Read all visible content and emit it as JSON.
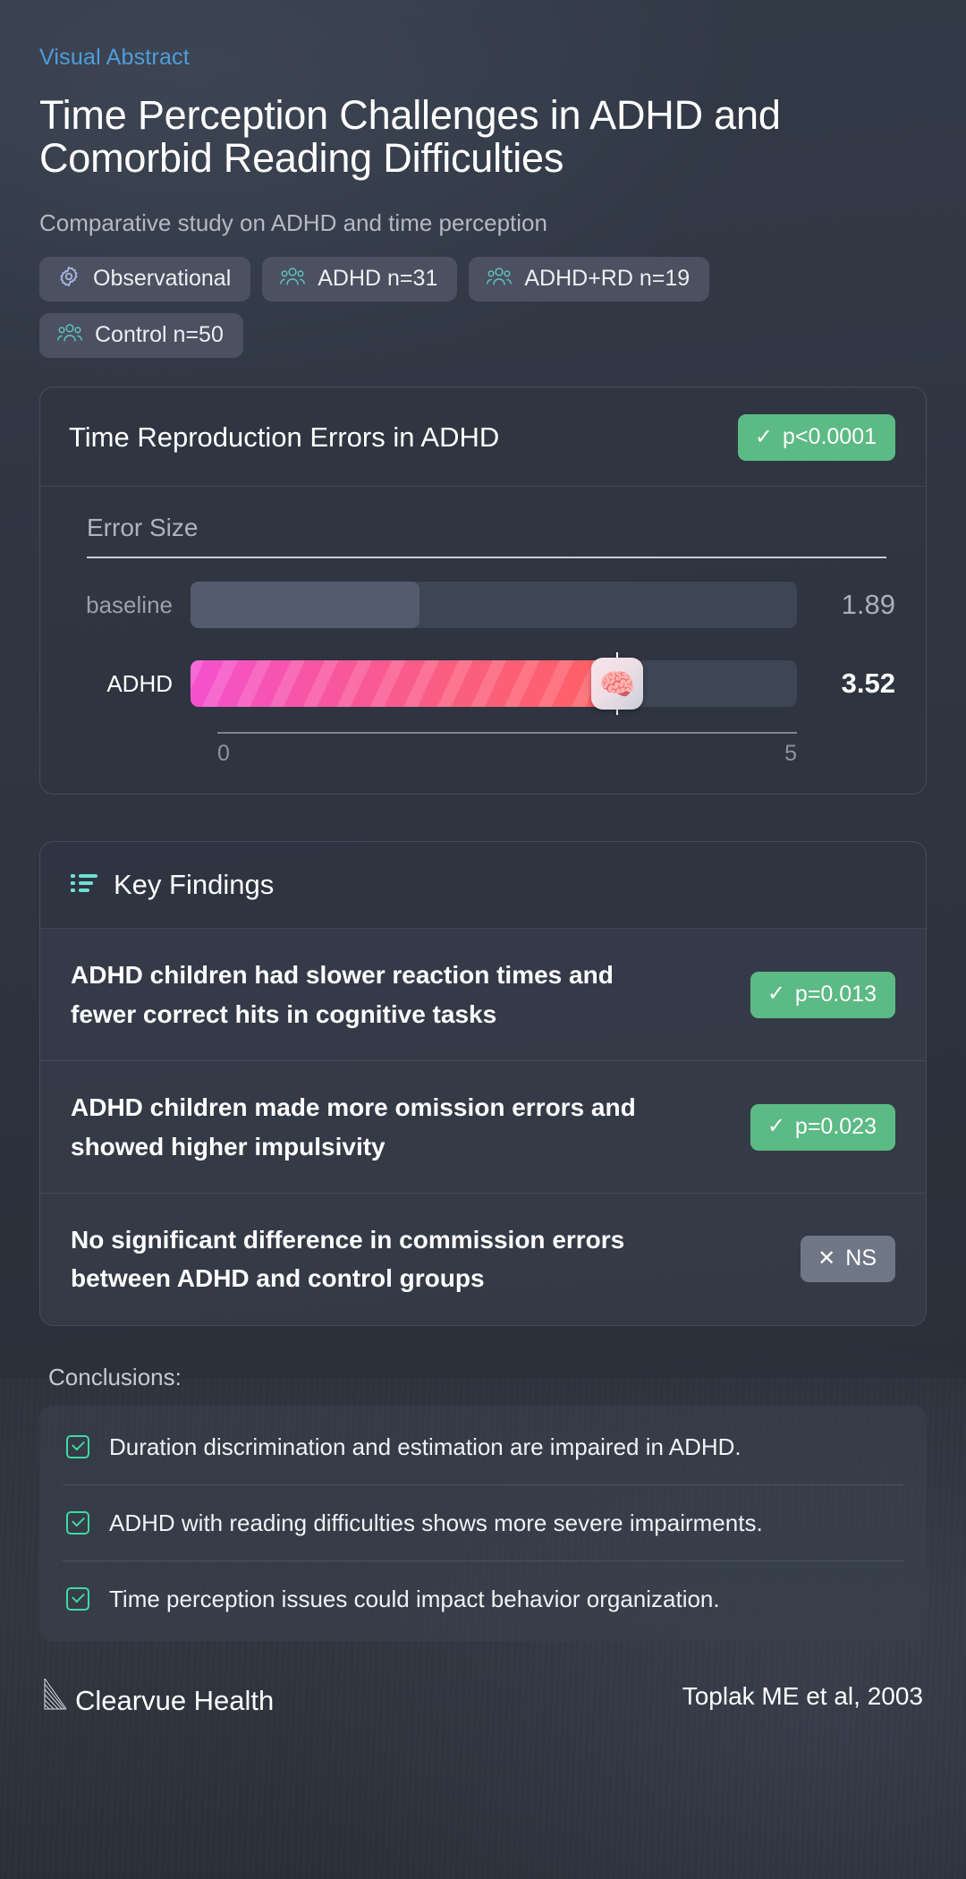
{
  "header": {
    "eyebrow": "Visual Abstract",
    "title": "Time Perception Challenges in ADHD and Comorbid Reading Difficulties",
    "subtitle": "Comparative study on ADHD and time perception"
  },
  "chips": [
    {
      "label": "Observational",
      "icon": "gear-icon"
    },
    {
      "label": "ADHD n=31",
      "icon": "people-icon"
    },
    {
      "label": "ADHD+RD n=19",
      "icon": "people-icon"
    },
    {
      "label": "Control n=50",
      "icon": "people-icon"
    }
  ],
  "chart_card": {
    "title": "Time Reproduction Errors in ADHD",
    "significance_badge": {
      "label": "p<0.0001",
      "icon": "check-icon",
      "color": "#5cba85"
    }
  },
  "chart_data": {
    "type": "bar",
    "title": "Time Reproduction Errors in ADHD",
    "xlabel": "Error Size",
    "ylabel": "",
    "categories": [
      "baseline",
      "ADHD"
    ],
    "values": [
      1.89,
      3.52
    ],
    "value_labels": [
      "1.89",
      "3.52"
    ],
    "xlim": [
      0,
      5
    ],
    "tick_labels": [
      "0",
      "5"
    ],
    "grid": false,
    "orientation": "horizontal",
    "highlight_category": "ADHD",
    "marker_icon": "brain-icon",
    "colors": {
      "baseline": "#545b6d",
      "primary_start": "#f452cf",
      "primary_end": "#ff6063",
      "track": "#3e4554"
    }
  },
  "key_findings": {
    "heading": "Key Findings",
    "icon": "list-icon",
    "items": [
      {
        "text": "ADHD children had slower reaction times and fewer correct hits in cognitive tasks",
        "badge": "p=0.013",
        "badge_icon": "check-icon",
        "badge_type": "significant"
      },
      {
        "text": "ADHD children made more omission errors and showed higher impulsivity",
        "badge": "p=0.023",
        "badge_icon": "check-icon",
        "badge_type": "significant"
      },
      {
        "text": "No significant difference in commission errors between ADHD and control groups",
        "badge": "NS",
        "badge_icon": "cross-icon",
        "badge_type": "not-significant"
      }
    ]
  },
  "conclusions": {
    "label": "Conclusions:",
    "items": [
      "Duration discrimination and estimation are impaired in ADHD.",
      "ADHD with reading difficulties shows more severe impairments.",
      "Time perception issues could impact behavior organization."
    ]
  },
  "footer": {
    "brand": "Clearvue Health",
    "brand_icon": "fan-logo-icon",
    "citation": "Toplak ME et al, 2003"
  }
}
